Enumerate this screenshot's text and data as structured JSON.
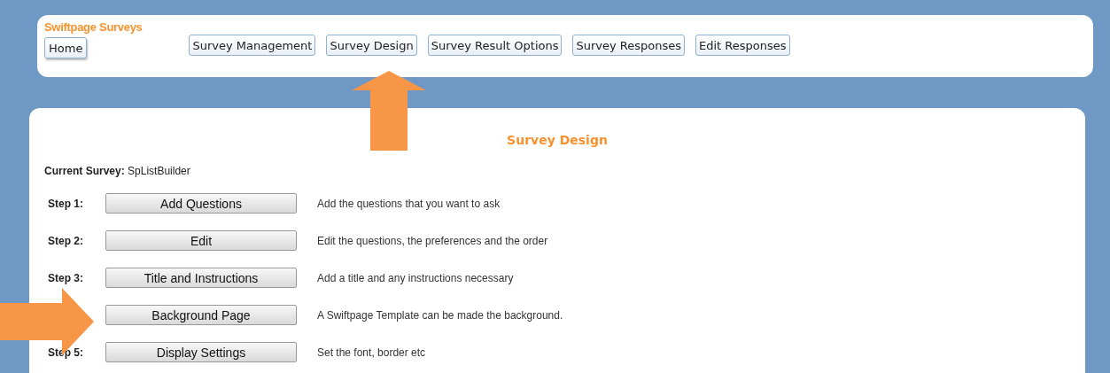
{
  "header": {
    "title": "Swiftpage Surveys",
    "home_button": "Home",
    "nav_buttons": [
      "Survey Management",
      "Survey Design",
      "Survey Result Options",
      "Survey Responses",
      "Edit Responses"
    ]
  },
  "main": {
    "title": "Survey Design",
    "current_survey_label": "Current Survey:",
    "current_survey": "SpListBuilder",
    "steps": [
      {
        "label": "Step 1:",
        "button": "Add Questions",
        "description": "Add the questions that you want to ask"
      },
      {
        "label": "Step 2:",
        "button": "Edit",
        "description": "Edit the questions, the preferences and the order"
      },
      {
        "label": "Step 3:",
        "button": "Title and Instructions",
        "description": "Add a title and any instructions necessary"
      },
      {
        "button": "Background Page",
        "description": "A Swiftpage Template can be made the background."
      },
      {
        "label": "Step 5:",
        "button": "Display Settings",
        "description": "Set the font, border etc"
      }
    ]
  }
}
